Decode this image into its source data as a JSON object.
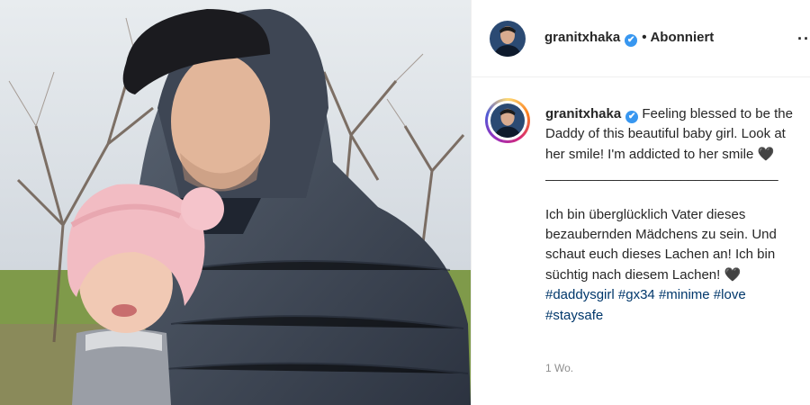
{
  "post": {
    "username": "granitxhaka",
    "verified_mark": "✔",
    "separator": "•",
    "follow_status": "Abonniert",
    "more_label": "···"
  },
  "caption": {
    "username": "granitxhaka",
    "en_text_1": "Feeling blessed to be the Daddy of this beautiful baby girl. Look at her smile! I'm addicted to her smile ",
    "heart": "🖤",
    "divider": "_______________________________",
    "de_text_1": "Ich bin überglücklich Vater dieses bezaubernden Mädchens zu sein. Und schaut euch dieses Lachen an! Ich bin süchtig nach diesem Lachen! ",
    "hashtags": [
      "#daddysgirl",
      "#gx34",
      "#minime",
      "#love",
      "#staysafe"
    ],
    "time_ago": "1 Wo."
  },
  "icons": {
    "verified": "verified-badge-icon",
    "more": "more-options-icon",
    "heart": "heart-icon"
  },
  "colors": {
    "link": "#00376b",
    "verified": "#3897f0",
    "text": "#262626",
    "muted": "#8e8e8e"
  }
}
